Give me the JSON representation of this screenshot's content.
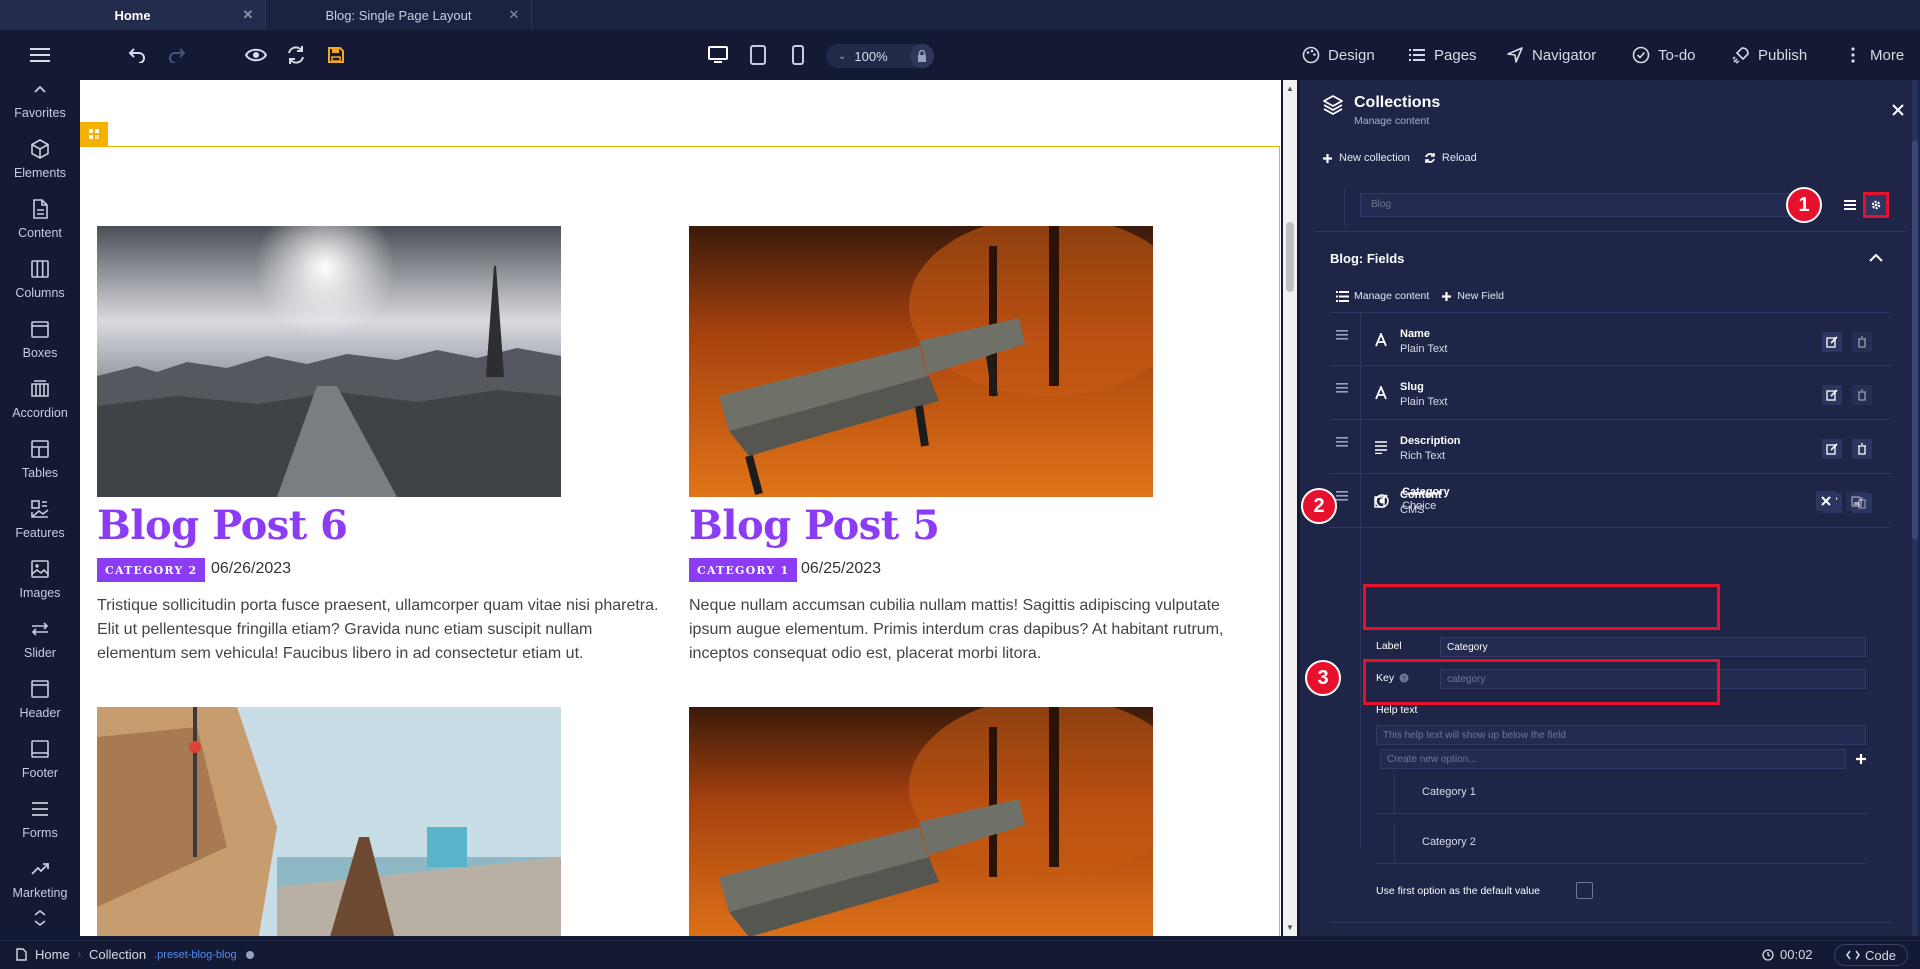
{
  "tabs": [
    {
      "label": "Home",
      "active": true
    },
    {
      "label": "Blog: Single Page Layout",
      "active": false
    }
  ],
  "toolbar": {
    "zoom": "100%",
    "menu": {
      "design": "Design",
      "pages": "Pages",
      "navigator": "Navigator",
      "todo": "To-do",
      "publish": "Publish",
      "more": "More"
    },
    "accent_save": "#f5a623"
  },
  "sidebar": {
    "items": [
      {
        "label": "Favorites",
        "icon": "chevron-up-icon"
      },
      {
        "label": "Elements",
        "icon": "cube-icon"
      },
      {
        "label": "Content",
        "icon": "document-icon"
      },
      {
        "label": "Columns",
        "icon": "columns-icon"
      },
      {
        "label": "Boxes",
        "icon": "box-icon"
      },
      {
        "label": "Accordion",
        "icon": "accordion-icon"
      },
      {
        "label": "Tables",
        "icon": "table-icon"
      },
      {
        "label": "Features",
        "icon": "features-icon"
      },
      {
        "label": "Images",
        "icon": "image-icon"
      },
      {
        "label": "Slider",
        "icon": "slider-icon"
      },
      {
        "label": "Header",
        "icon": "header-icon"
      },
      {
        "label": "Footer",
        "icon": "footer-icon"
      },
      {
        "label": "Forms",
        "icon": "forms-icon"
      },
      {
        "label": "Marketing",
        "icon": "marketing-icon"
      }
    ]
  },
  "canvas": {
    "posts": [
      {
        "title": "Blog Post 6",
        "category": "CATEGORY 2",
        "date": "06/26/2023",
        "excerpt": "Tristique sollicitudin porta fusce praesent, ullamcorper quam vitae nisi pharetra. Elit ut pellentesque fringilla etiam? Gravida nunc etiam suscipit nullam elementum sem vehicula! Faucibus libero in ad consectetur etiam ut.",
        "image": "paris-cityscape"
      },
      {
        "title": "Blog Post 5",
        "category": "CATEGORY 1",
        "date": "06/25/2023",
        "excerpt": "Neque nullam accumsan cubilia nullam mattis! Sagittis adipiscing vulputate ipsum augue elementum. Primis interdum cras dapibus? At habitant rutrum, inceptos consequat odio est, placerat morbi litora.",
        "image": "autumn-bench"
      }
    ],
    "accent": "#8c3cf5",
    "selection": "#f5b100"
  },
  "panel": {
    "title": "Collections",
    "subtitle": "Manage content",
    "new_collection": "New collection",
    "reload": "Reload",
    "collection_placeholder": "Blog",
    "fields_title": "Blog: Fields",
    "manage_content": "Manage content",
    "new_field": "New Field",
    "fields": [
      {
        "name": "Name",
        "type": "Plain Text",
        "icon": "text-a-icon"
      },
      {
        "name": "Slug",
        "type": "Plain Text",
        "icon": "text-a-icon"
      },
      {
        "name": "Description",
        "type": "Rich Text",
        "icon": "paragraph-icon"
      },
      {
        "name": "Content",
        "type": "CMS",
        "icon": "edit-icon"
      }
    ],
    "expanded": {
      "name": "Category",
      "type": "Choice",
      "label_caption": "Label",
      "label_value": "Category",
      "key_caption": "Key",
      "key_placeholder": "category",
      "help_caption": "Help text",
      "help_placeholder": "This help text will show up below the field",
      "option_placeholder": "Create new option...",
      "options": [
        "Category 1",
        "Category 2"
      ],
      "default_caption": "Use first option as the default value"
    },
    "annotations": [
      "1",
      "2",
      "3"
    ]
  },
  "statusbar": {
    "home": "Home",
    "collection": "Collection",
    "slug": ".preset-blog-blog",
    "time": "00:02",
    "code": "Code"
  }
}
